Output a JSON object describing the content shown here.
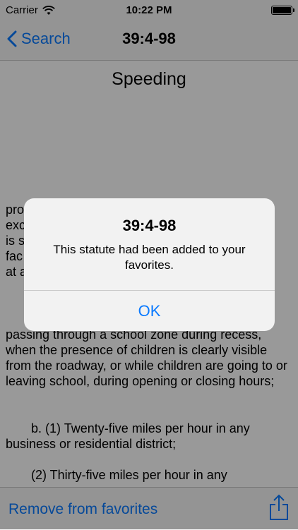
{
  "status": {
    "carrier": "Carrier",
    "time": "10:22 PM"
  },
  "nav": {
    "back_label": "Search",
    "title": "39:4-98"
  },
  "content": {
    "heading": "Speeding",
    "fragment_lines": [
      "pro",
      "exc",
      "is s",
      "fac",
      "at a"
    ],
    "body": "passing through a school zone during recess, when the presence of children is clearly visible from the roadway, or while children are going to or leaving school, during opening or closing hours;",
    "sub_b": "b. (1) Twenty-five miles per hour in any business or residential district;",
    "sub_2": "(2)  Thirty-five miles per hour in any"
  },
  "toolbar": {
    "remove_label": "Remove from favorites"
  },
  "alert": {
    "title": "39:4-98",
    "message": "This statute had been added to your favorites.",
    "ok_label": "OK"
  }
}
